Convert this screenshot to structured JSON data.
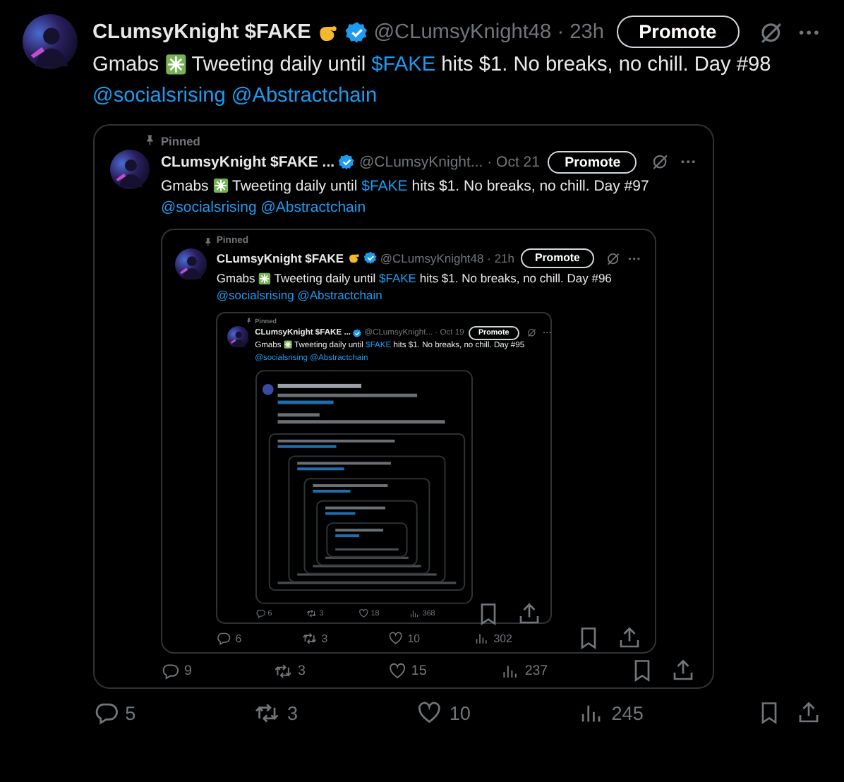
{
  "tweet": {
    "author": {
      "name": "CLumsyKnight $FAKE",
      "hand_emoji": true,
      "handle": "@CLumsyKnight48",
      "time": "· 23h"
    },
    "promote_label": "Promote",
    "text": [
      {
        "kind": "text",
        "text": "Gmabs"
      },
      {
        "kind": "emoji"
      },
      {
        "kind": "text",
        "text": "Tweeting daily until"
      },
      {
        "kind": "link",
        "text": "$FAKE"
      },
      {
        "kind": "text",
        "text": "hits $1. No breaks, no chill. Day #98"
      }
    ],
    "mentions": [
      "@socialsrising",
      "@Abstractchain"
    ],
    "stats": {
      "replies": "5",
      "reposts": "3",
      "likes": "10",
      "views": "245"
    },
    "quote": {
      "pinned_label": "Pinned",
      "author": {
        "name": "CLumsyKnight $FAKE ...",
        "hand_emoji": false,
        "handle": "@CLumsyKnight...",
        "time": "· Oct 21"
      },
      "promote_label": "Promote",
      "text": [
        {
          "kind": "text",
          "text": "Gmabs"
        },
        {
          "kind": "emoji"
        },
        {
          "kind": "text",
          "text": "Tweeting daily until"
        },
        {
          "kind": "link",
          "text": "$FAKE"
        },
        {
          "kind": "text",
          "text": "hits $1. No breaks, no chill. Day #97"
        }
      ],
      "mentions": [
        "@socialsrising",
        "@Abstractchain"
      ],
      "stats": {
        "replies": "9",
        "reposts": "3",
        "likes": "15",
        "views": "237"
      },
      "quote": {
        "pinned_label": "Pinned",
        "author": {
          "name": "CLumsyKnight $FAKE",
          "hand_emoji": true,
          "handle": "@CLumsyKnight48",
          "time": "· 21h"
        },
        "promote_label": "Promote",
        "text": [
          {
            "kind": "text",
            "text": "Gmabs"
          },
          {
            "kind": "emoji"
          },
          {
            "kind": "text",
            "text": "Tweeting daily until"
          },
          {
            "kind": "link",
            "text": "$FAKE"
          },
          {
            "kind": "text",
            "text": "hits $1. No breaks, no chill. Day #96"
          }
        ],
        "mentions": [
          "@socialsrising",
          "@Abstractchain"
        ],
        "stats": {
          "replies": "6",
          "reposts": "3",
          "likes": "10",
          "views": "302"
        },
        "quote": {
          "pinned_label": "Pinned",
          "author": {
            "name": "CLumsyKnight $FAKE ...",
            "hand_emoji": false,
            "handle": "@CLumsyKnight...",
            "time": "· Oct 19"
          },
          "promote_label": "Promote",
          "text": [
            {
              "kind": "text",
              "text": "Gmabs"
            },
            {
              "kind": "emoji"
            },
            {
              "kind": "text",
              "text": "Tweeting daily until"
            },
            {
              "kind": "link",
              "text": "$FAKE"
            },
            {
              "kind": "text",
              "text": "hits $1. No breaks, no chill. Day #95"
            }
          ],
          "mentions": [
            "@socialsrising",
            "@Abstractchain"
          ],
          "stats": {
            "replies": "6",
            "reposts": "3",
            "likes": "18",
            "views": "368"
          }
        }
      }
    }
  }
}
